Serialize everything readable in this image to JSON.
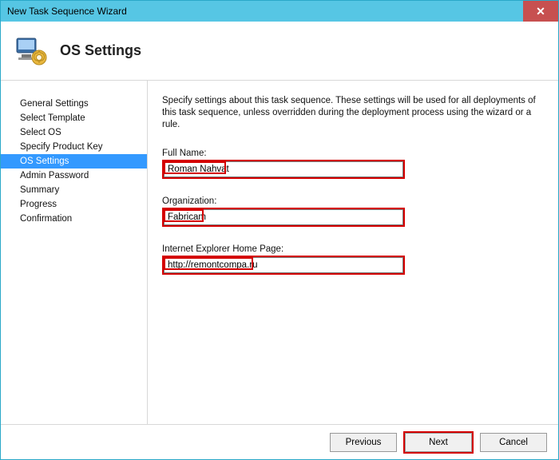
{
  "window": {
    "title": "New Task Sequence Wizard",
    "close_glyph": "✕"
  },
  "header": {
    "title": "OS Settings"
  },
  "sidebar": {
    "items": [
      {
        "label": "General Settings",
        "selected": false
      },
      {
        "label": "Select Template",
        "selected": false
      },
      {
        "label": "Select OS",
        "selected": false
      },
      {
        "label": "Specify Product Key",
        "selected": false
      },
      {
        "label": "OS Settings",
        "selected": true
      },
      {
        "label": "Admin Password",
        "selected": false
      },
      {
        "label": "Summary",
        "selected": false
      },
      {
        "label": "Progress",
        "selected": false
      },
      {
        "label": "Confirmation",
        "selected": false
      }
    ]
  },
  "content": {
    "intro": "Specify settings about this task sequence.  These settings will be used for all deployments of this task sequence, unless overridden during the deployment process using the wizard or a rule.",
    "full_name_label": "Full Name:",
    "full_name_value": "Roman Nahvat",
    "organization_label": "Organization:",
    "organization_value": "Fabricam",
    "ie_home_label": "Internet Explorer Home Page:",
    "ie_home_value": "http://remontcompa.ru"
  },
  "footer": {
    "previous": "Previous",
    "next": "Next",
    "cancel": "Cancel"
  }
}
